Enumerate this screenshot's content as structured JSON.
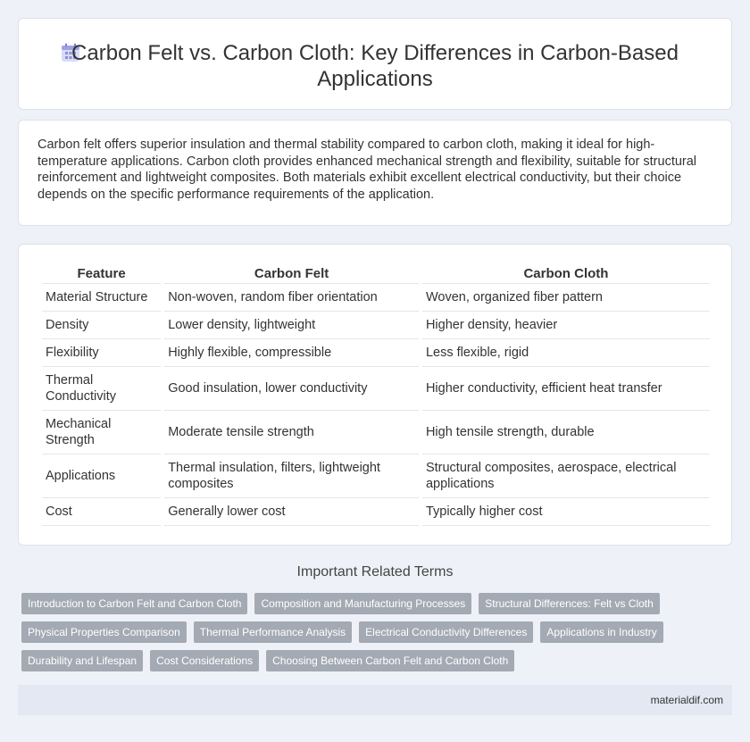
{
  "header": {
    "icon": "calendar-grid-icon",
    "title": "Carbon Felt vs. Carbon Cloth: Key Differences in Carbon-Based Applications"
  },
  "summary": "Carbon felt offers superior insulation and thermal stability compared to carbon cloth, making it ideal for high-temperature applications. Carbon cloth provides enhanced mechanical strength and flexibility, suitable for structural reinforcement and lightweight composites. Both materials exhibit excellent electrical conductivity, but their choice depends on the specific performance requirements of the application.",
  "table": {
    "headers": [
      "Feature",
      "Carbon Felt",
      "Carbon Cloth"
    ],
    "rows": [
      [
        "Material Structure",
        "Non-woven, random fiber orientation",
        "Woven, organized fiber pattern"
      ],
      [
        "Density",
        "Lower density, lightweight",
        "Higher density, heavier"
      ],
      [
        "Flexibility",
        "Highly flexible, compressible",
        "Less flexible, rigid"
      ],
      [
        "Thermal Conductivity",
        "Good insulation, lower conductivity",
        "Higher conductivity, efficient heat transfer"
      ],
      [
        "Mechanical Strength",
        "Moderate tensile strength",
        "High tensile strength, durable"
      ],
      [
        "Applications",
        "Thermal insulation, filters, lightweight composites",
        "Structural composites, aerospace, electrical applications"
      ],
      [
        "Cost",
        "Generally lower cost",
        "Typically higher cost"
      ]
    ]
  },
  "related": {
    "title": "Important Related Terms",
    "tags": [
      [
        "Introduction to Carbon Felt and Carbon Cloth",
        "Composition and Manufacturing Processes",
        "Structural Differences: Felt vs Cloth"
      ],
      [
        "Physical Properties Comparison",
        "Thermal Performance Analysis",
        "Electrical Conductivity Differences",
        "Applications in Industry"
      ],
      [
        "Durability and Lifespan",
        "Cost Considerations",
        "Choosing Between Carbon Felt and Carbon Cloth"
      ]
    ]
  },
  "footer": {
    "site": "materialdif.com"
  },
  "colors": {
    "background": "#eef1f7",
    "tag": "#a4aab3",
    "footer": "#e3e8f2",
    "icon": "#8b8fd9"
  }
}
